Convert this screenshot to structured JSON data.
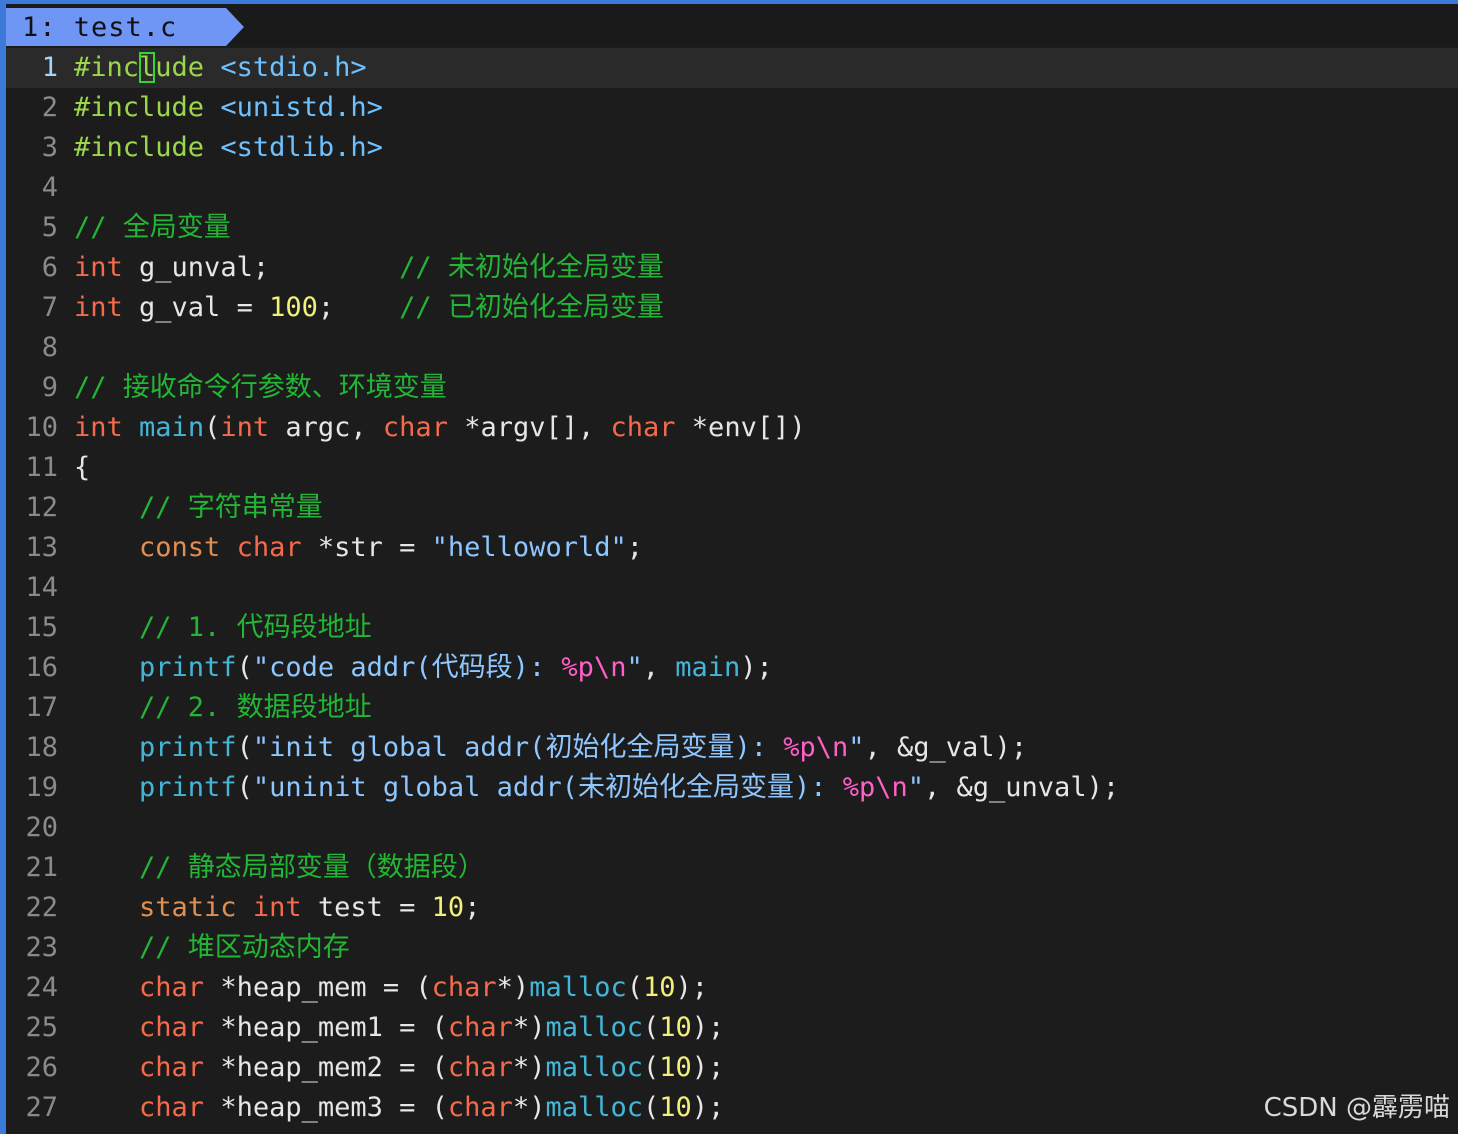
{
  "tab": {
    "label": "1: test.c"
  },
  "editor": {
    "lines": [
      {
        "num": "1",
        "segments": [
          [
            "pp",
            "#inc"
          ],
          [
            "pp cursor",
            "l"
          ],
          [
            "pp",
            "ude"
          ],
          [
            "id",
            " "
          ],
          [
            "hdr",
            "<stdio.h>"
          ]
        ]
      },
      {
        "num": "2",
        "segments": [
          [
            "pp",
            "#include"
          ],
          [
            "id",
            " "
          ],
          [
            "hdr",
            "<unistd.h>"
          ]
        ]
      },
      {
        "num": "3",
        "segments": [
          [
            "pp",
            "#include"
          ],
          [
            "id",
            " "
          ],
          [
            "hdr",
            "<stdlib.h>"
          ]
        ]
      },
      {
        "num": "4",
        "segments": []
      },
      {
        "num": "5",
        "segments": [
          [
            "cm",
            "// 全局变量"
          ]
        ]
      },
      {
        "num": "6",
        "segments": [
          [
            "kw",
            "int"
          ],
          [
            "id",
            " g_unval;        "
          ],
          [
            "cm",
            "// 未初始化全局变量"
          ]
        ]
      },
      {
        "num": "7",
        "segments": [
          [
            "kw",
            "int"
          ],
          [
            "id",
            " g_val = "
          ],
          [
            "num",
            "100"
          ],
          [
            "id",
            ";    "
          ],
          [
            "cm",
            "// 已初始化全局变量"
          ]
        ]
      },
      {
        "num": "8",
        "segments": []
      },
      {
        "num": "9",
        "segments": [
          [
            "cm",
            "// 接收命令行参数、环境变量"
          ]
        ]
      },
      {
        "num": "10",
        "segments": [
          [
            "kw",
            "int"
          ],
          [
            "id",
            " "
          ],
          [
            "fn",
            "main"
          ],
          [
            "id",
            "("
          ],
          [
            "kw",
            "int"
          ],
          [
            "id",
            " argc, "
          ],
          [
            "kw",
            "char"
          ],
          [
            "id",
            " *argv[], "
          ],
          [
            "kw",
            "char"
          ],
          [
            "id",
            " *env[])"
          ]
        ]
      },
      {
        "num": "11",
        "segments": [
          [
            "id",
            "{"
          ]
        ]
      },
      {
        "num": "12",
        "segments": [
          [
            "id",
            "    "
          ],
          [
            "cm",
            "// 字符串常量"
          ]
        ]
      },
      {
        "num": "13",
        "segments": [
          [
            "id",
            "    "
          ],
          [
            "kw2",
            "const"
          ],
          [
            "id",
            " "
          ],
          [
            "kw",
            "char"
          ],
          [
            "id",
            " *str = "
          ],
          [
            "str",
            "\"helloworld\""
          ],
          [
            "id",
            ";"
          ]
        ]
      },
      {
        "num": "14",
        "segments": []
      },
      {
        "num": "15",
        "segments": [
          [
            "id",
            "    "
          ],
          [
            "cm",
            "// 1. 代码段地址"
          ]
        ]
      },
      {
        "num": "16",
        "segments": [
          [
            "id",
            "    "
          ],
          [
            "fn",
            "printf"
          ],
          [
            "id",
            "("
          ],
          [
            "str",
            "\"code addr(代码段): "
          ],
          [
            "fmt",
            "%p\\n"
          ],
          [
            "str",
            "\""
          ],
          [
            "id",
            ", "
          ],
          [
            "fn",
            "main"
          ],
          [
            "id",
            ");"
          ]
        ]
      },
      {
        "num": "17",
        "segments": [
          [
            "id",
            "    "
          ],
          [
            "cm",
            "// 2. 数据段地址"
          ]
        ]
      },
      {
        "num": "18",
        "segments": [
          [
            "id",
            "    "
          ],
          [
            "fn",
            "printf"
          ],
          [
            "id",
            "("
          ],
          [
            "str",
            "\"init global addr(初始化全局变量): "
          ],
          [
            "fmt",
            "%p\\n"
          ],
          [
            "str",
            "\""
          ],
          [
            "id",
            ", &g_val);"
          ]
        ]
      },
      {
        "num": "19",
        "segments": [
          [
            "id",
            "    "
          ],
          [
            "fn",
            "printf"
          ],
          [
            "id",
            "("
          ],
          [
            "str",
            "\"uninit global addr(未初始化全局变量): "
          ],
          [
            "fmt",
            "%p\\n"
          ],
          [
            "str",
            "\""
          ],
          [
            "id",
            ", &g_unval);"
          ]
        ]
      },
      {
        "num": "20",
        "segments": []
      },
      {
        "num": "21",
        "segments": [
          [
            "id",
            "    "
          ],
          [
            "cm",
            "// 静态局部变量（数据段）"
          ]
        ]
      },
      {
        "num": "22",
        "segments": [
          [
            "id",
            "    "
          ],
          [
            "kw2",
            "static"
          ],
          [
            "id",
            " "
          ],
          [
            "kw",
            "int"
          ],
          [
            "id",
            " test = "
          ],
          [
            "num",
            "10"
          ],
          [
            "id",
            ";"
          ]
        ]
      },
      {
        "num": "23",
        "segments": [
          [
            "id",
            "    "
          ],
          [
            "cm",
            "// 堆区动态内存"
          ]
        ]
      },
      {
        "num": "24",
        "segments": [
          [
            "id",
            "    "
          ],
          [
            "kw",
            "char"
          ],
          [
            "id",
            " *heap_mem = ("
          ],
          [
            "kw",
            "char"
          ],
          [
            "id",
            "*)"
          ],
          [
            "fn",
            "malloc"
          ],
          [
            "id",
            "("
          ],
          [
            "num",
            "10"
          ],
          [
            "id",
            ");"
          ]
        ]
      },
      {
        "num": "25",
        "segments": [
          [
            "id",
            "    "
          ],
          [
            "kw",
            "char"
          ],
          [
            "id",
            " *heap_mem1 = ("
          ],
          [
            "kw",
            "char"
          ],
          [
            "id",
            "*)"
          ],
          [
            "fn",
            "malloc"
          ],
          [
            "id",
            "("
          ],
          [
            "num",
            "10"
          ],
          [
            "id",
            ");"
          ]
        ]
      },
      {
        "num": "26",
        "segments": [
          [
            "id",
            "    "
          ],
          [
            "kw",
            "char"
          ],
          [
            "id",
            " *heap_mem2 = ("
          ],
          [
            "kw",
            "char"
          ],
          [
            "id",
            "*)"
          ],
          [
            "fn",
            "malloc"
          ],
          [
            "id",
            "("
          ],
          [
            "num",
            "10"
          ],
          [
            "id",
            ");"
          ]
        ]
      },
      {
        "num": "27",
        "segments": [
          [
            "id",
            "    "
          ],
          [
            "kw",
            "char"
          ],
          [
            "id",
            " *heap_mem3 = ("
          ],
          [
            "kw",
            "char"
          ],
          [
            "id",
            "*)"
          ],
          [
            "fn",
            "malloc"
          ],
          [
            "id",
            "("
          ],
          [
            "num",
            "10"
          ],
          [
            "id",
            ");"
          ]
        ]
      }
    ]
  },
  "watermark": {
    "text": "CSDN @霹雳喵"
  }
}
